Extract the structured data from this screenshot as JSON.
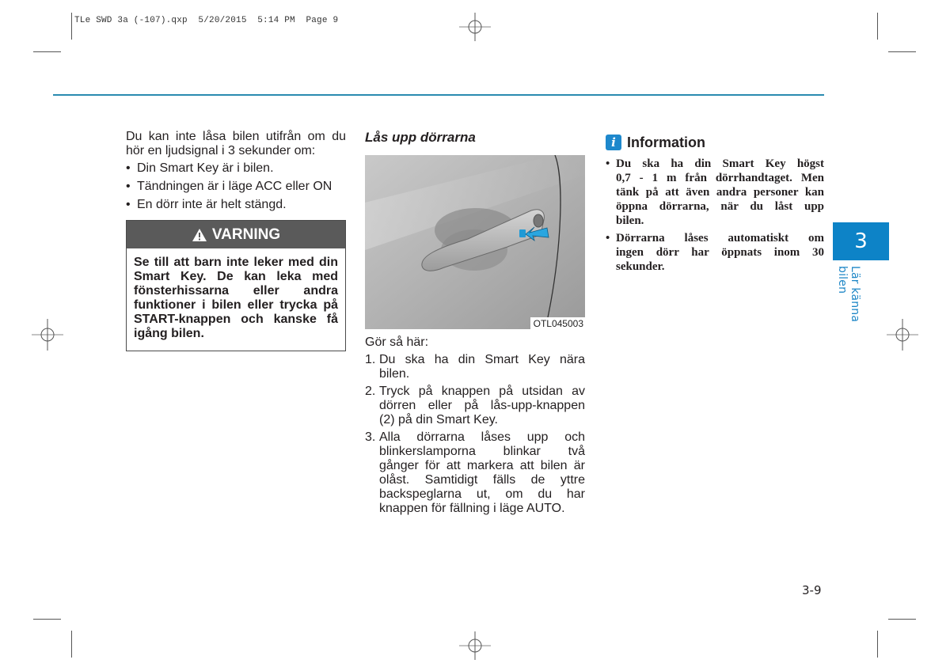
{
  "slug": "TLe SWD 3a (-107).qxp  5/20/2015  5:14 PM  Page 9",
  "column1": {
    "intro": "Du kan inte låsa bilen utifrån om du hör en ljudsignal i 3 sekunder om:",
    "intro_lines": [
      "Du kan inte låsa bilen utifrån om du",
      "hör en ljudsignal i 3 sekunder om:"
    ],
    "bullets": [
      "Din Smart Key är i bilen.",
      "Tändningen är i läge ACC eller ON",
      "En dörr inte är helt stängd."
    ],
    "warning": {
      "icon": "warning-triangle-icon",
      "title": "VARNING",
      "lines": [
        "Se till att barn inte leker med din",
        "Smart Key. De kan leka med",
        "fönsterhissarna eller andra",
        "funktioner i bilen eller trycka på",
        "START-knappen och kanske få",
        "igång bilen."
      ]
    }
  },
  "column2": {
    "title": "Lås upp dörrarna",
    "figure": {
      "code": "OTL045003",
      "description": "Door handle with highlighted button and blue arrow",
      "arrow_color": "#2aa6e0"
    },
    "lead": "Gör så här:",
    "steps": [
      {
        "num": "1.",
        "lines": [
          "Du ska ha din Smart Key nära",
          "bilen."
        ]
      },
      {
        "num": "2.",
        "lines": [
          "Tryck på knappen på utsidan av",
          "dörren eller på lås-upp-knappen",
          "(2) på din Smart Key."
        ]
      },
      {
        "num": "3.",
        "lines": [
          "Alla dörrarna låses upp och",
          "blinkerslamporna blinkar två",
          "gånger för att markera att bilen är",
          "olåst. Samtidigt fälls de yttre",
          "backspeglarna ut, om du har",
          "knappen för fällning i läge AUTO."
        ]
      }
    ]
  },
  "column3": {
    "info": {
      "icon": "info-icon",
      "icon_glyph": "i",
      "title": "Information",
      "items": [
        {
          "lines": [
            "Du ska ha din Smart Key högst",
            "0,7 - 1 m från dörrhandtaget. Men",
            "tänk på att även andra personer kan",
            "öppna dörrarna, när du låst upp",
            "bilen."
          ]
        },
        {
          "lines": [
            "Dörrarna låses automatiskt om",
            "ingen dörr har öppnats inom 30",
            "sekunder."
          ]
        }
      ]
    }
  },
  "chapter": {
    "number": "3",
    "label": "Lär känna bilen",
    "color": "#0d83c7"
  },
  "page_number": "3-9",
  "colors": {
    "rule": "#2a8bb0",
    "warning_header": "#5a5a5a",
    "info_icon": "#1e88cc"
  }
}
